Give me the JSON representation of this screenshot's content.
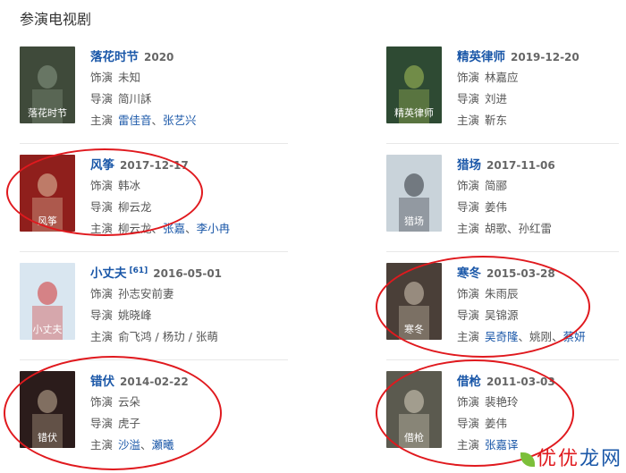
{
  "section_title": "参演电视剧",
  "labels": {
    "role": "饰演",
    "director": "导演",
    "starring": "主演"
  },
  "shows": [
    {
      "title": "落花时节",
      "date": "2020",
      "role": "未知",
      "director": [
        "简川訸"
      ],
      "cast": [
        "雷佳音",
        "张艺兴"
      ],
      "cast_sep": "、",
      "cast_linked": [
        true,
        true
      ],
      "poster": {
        "bg": "#3f4a3a",
        "accent": "#8a9a86",
        "caption": "落花时节"
      }
    },
    {
      "title": "精英律师",
      "date": "2019-12-20",
      "role": "林嘉应",
      "director": [
        "刘进"
      ],
      "cast": [
        "靳东"
      ],
      "cast_sep": "、",
      "cast_linked": [
        false
      ],
      "poster": {
        "bg": "#2e4a33",
        "accent": "#a9c25a",
        "caption": "精英律师"
      }
    },
    {
      "title": "风筝",
      "date": "2017-12-17",
      "role": "韩冰",
      "director": [
        "柳云龙"
      ],
      "cast": [
        "柳云龙",
        "张嘉",
        "李小冉"
      ],
      "cast_sep": "、",
      "cast_linked": [
        false,
        true,
        true
      ],
      "poster": {
        "bg": "#8f1f1c",
        "accent": "#e6c6a8",
        "caption": "风筝"
      }
    },
    {
      "title": "猎场",
      "date": "2017-11-06",
      "role": "简郦",
      "director": [
        "姜伟"
      ],
      "cast": [
        "胡歌",
        "孙红雷"
      ],
      "cast_sep": "、",
      "cast_linked": [
        false,
        false
      ],
      "poster": {
        "bg": "#c9d3da",
        "accent": "#2a2f36",
        "caption": "猎场"
      }
    },
    {
      "title": "小丈夫",
      "sup": "[61]",
      "date": "2016-05-01",
      "role": "孙志安前妻",
      "director": [
        "姚晓峰"
      ],
      "cast": [
        "俞飞鸿",
        "杨玏",
        "张萌"
      ],
      "cast_sep": " / ",
      "cast_linked": [
        false,
        false,
        false
      ],
      "poster": {
        "bg": "#d9e6f0",
        "accent": "#d2302f",
        "caption": "小丈夫"
      }
    },
    {
      "title": "寒冬",
      "date": "2015-03-28",
      "role": "朱雨辰",
      "director": [
        "吴锦源"
      ],
      "cast": [
        "吴奇隆",
        "姚刚",
        "蔡妍"
      ],
      "cast_sep": "、",
      "cast_linked": [
        true,
        false,
        true
      ],
      "poster": {
        "bg": "#4a3f38",
        "accent": "#d7cbb8",
        "caption": "寒冬"
      }
    },
    {
      "title": "错伏",
      "date": "2014-02-22",
      "role": "云朵",
      "director": [
        "虎子"
      ],
      "cast": [
        "沙溢",
        "瀬曦"
      ],
      "cast_sep": "、",
      "cast_linked": [
        true,
        true
      ],
      "poster": {
        "bg": "#2b1c1b",
        "accent": "#c9b49a",
        "caption": "错伏"
      }
    },
    {
      "title": "借枪",
      "date": "2011-03-03",
      "role": "裴艳玲",
      "director": [
        "姜伟"
      ],
      "cast": [
        "张嘉译"
      ],
      "cast_sep": "、",
      "cast_linked": [
        true
      ],
      "poster": {
        "bg": "#5b5a4f",
        "accent": "#ddd6c2",
        "caption": "借枪"
      }
    }
  ],
  "watermark": {
    "text": "优优龙网",
    "colors": [
      "#e0191e",
      "#1a57a8"
    ]
  }
}
